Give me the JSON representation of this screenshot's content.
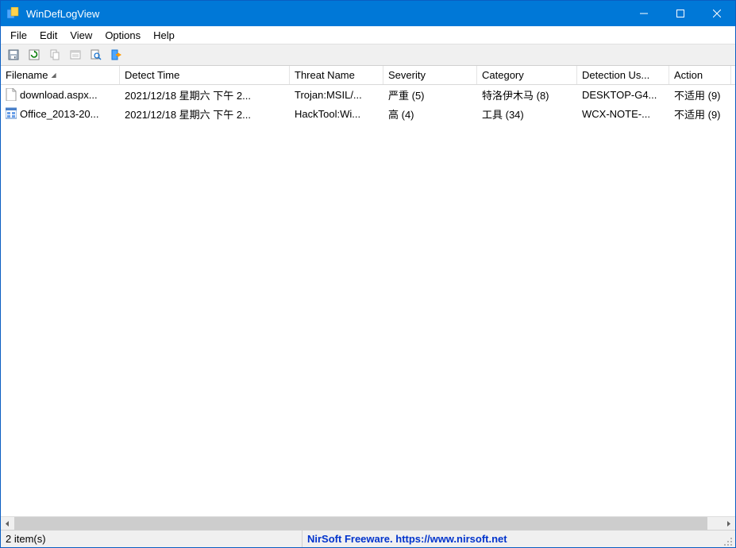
{
  "window": {
    "title": "WinDefLogView"
  },
  "menu": {
    "file": "File",
    "edit": "Edit",
    "view": "View",
    "options": "Options",
    "help": "Help"
  },
  "columns": {
    "filename": "Filename",
    "detect_time": "Detect Time",
    "threat_name": "Threat Name",
    "severity": "Severity",
    "category": "Category",
    "detection_user": "Detection Us...",
    "action": "Action"
  },
  "rows": [
    {
      "filename": "download.aspx...",
      "detect_time": "2021/12/18 星期六 下午 2...",
      "threat_name": "Trojan:MSIL/...",
      "severity": "严重 (5)",
      "category": "特洛伊木马 (8)",
      "detection_user": "DESKTOP-G4...",
      "action": "不适用 (9)",
      "icon": "blank-file"
    },
    {
      "filename": "Office_2013-20...",
      "detect_time": "2021/12/18 星期六 下午 2...",
      "threat_name": "HackTool:Wi...",
      "severity": "高 (4)",
      "category": "工具 (34)",
      "detection_user": "WCX-NOTE-...",
      "action": "不适用 (9)",
      "icon": "exe-file"
    }
  ],
  "status": {
    "count": "2 item(s)",
    "credit": "NirSoft Freeware. https://www.nirsoft.net"
  }
}
